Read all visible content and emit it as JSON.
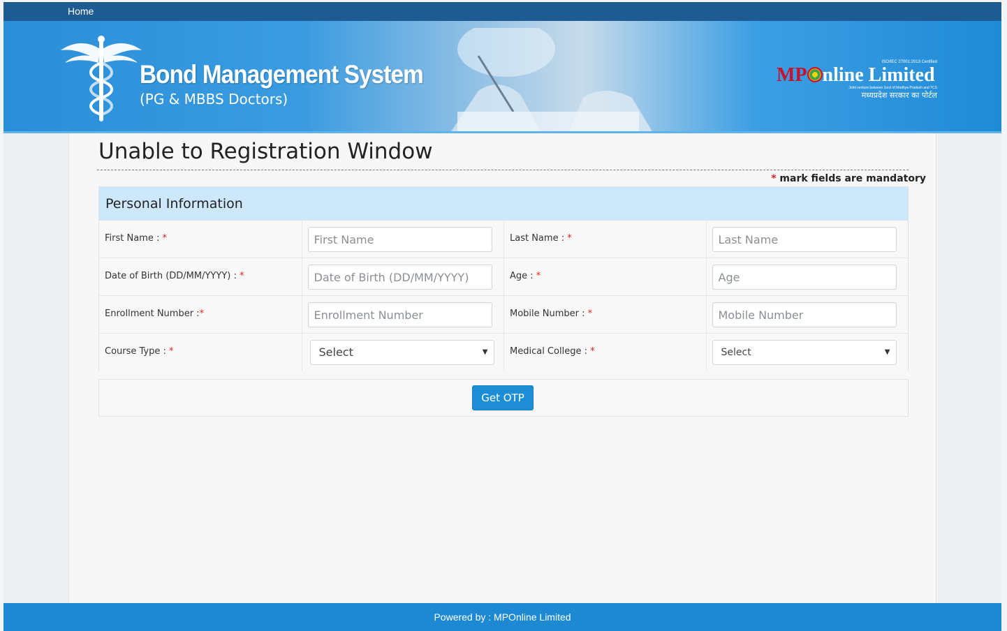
{
  "nav": {
    "home_label": "Home"
  },
  "banner": {
    "title": "Bond Management System",
    "subtitle": "(PG & MBBS Doctors)",
    "logo": {
      "mp": "MP",
      "online": "nline Limited",
      "iso": "ISO/IEC 27001:2013 Certified",
      "joint_venture": "Joint venture between Govt of Madhya Pradesh and TCS",
      "hindi": "मध्यप्रदेश सरकार का पोर्टल"
    }
  },
  "page": {
    "title": "Unable to Registration Window",
    "mandatory_star": "*",
    "mandatory_note": " mark fields are mandatory"
  },
  "section": {
    "title": "Personal Information"
  },
  "form": {
    "first_name": {
      "label": "First Name : ",
      "placeholder": "First Name"
    },
    "last_name": {
      "label": "Last Name : ",
      "placeholder": "Last Name"
    },
    "dob": {
      "label": "Date of Birth (DD/MM/YYYY) : ",
      "placeholder": "Date of Birth (DD/MM/YYYY)"
    },
    "age": {
      "label": "Age : ",
      "placeholder": "Age"
    },
    "enrollment": {
      "label": "Enrollment Number :",
      "placeholder": "Enrollment Number"
    },
    "mobile": {
      "label": "Mobile Number : ",
      "placeholder": "Mobile Number"
    },
    "course_type": {
      "label": "Course Type : ",
      "selected": "Select"
    },
    "medical_college": {
      "label": "Medical College : ",
      "selected": "Select"
    },
    "star": "*"
  },
  "actions": {
    "get_otp": "Get OTP"
  },
  "footer": {
    "text": "Powered by : MPOnline Limited"
  },
  "colors": {
    "nav": "#1e5b93",
    "banner": "#2a8fd9",
    "panel_header": "#cde8fb",
    "button": "#1d8ed6",
    "required": "#e02020",
    "footer": "#1e89d3"
  }
}
